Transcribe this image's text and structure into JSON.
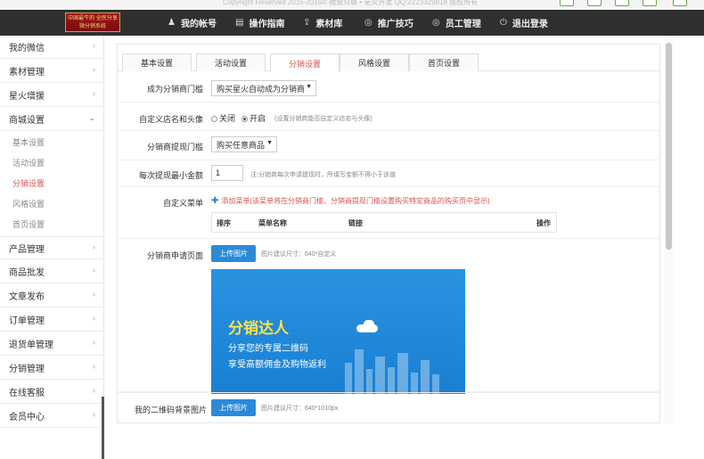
{
  "topbar": {
    "copyright": "Copyright Reserved 2015-2016© 微聚众联 • 星火开发 QQ:2223329818 版权所有"
  },
  "logo": {
    "text": "中国最牛的 全民分享微分销系统"
  },
  "nav": [
    {
      "label": "我的帐号",
      "icon": "user-icon"
    },
    {
      "label": "操作指南",
      "icon": "book-icon"
    },
    {
      "label": "素材库",
      "icon": "upload-icon"
    },
    {
      "label": "推广技巧",
      "icon": "globe-icon"
    },
    {
      "label": "员工管理",
      "icon": "globe-icon"
    },
    {
      "label": "退出登录",
      "icon": "power-icon"
    }
  ],
  "sidebar": {
    "items_top": [
      "我的微信",
      "素材管理",
      "星火增援",
      "商城设置"
    ],
    "sub_items": [
      "基本设置",
      "活动设置",
      "分销设置",
      "风格设置",
      "首页设置"
    ],
    "active_sub": "分销设置",
    "items_bottom": [
      "产品管理",
      "商品批发",
      "文章发布",
      "订单管理",
      "退货单管理",
      "分销管理",
      "在线客服",
      "会员中心"
    ]
  },
  "tabs": [
    "基本设置",
    "活动设置",
    "分销设置",
    "风格设置",
    "首页设置"
  ],
  "active_tab": "分销设置",
  "form": {
    "threshold_label": "成为分销商门槛",
    "threshold_value": "购买星火自动成为分销商",
    "custom_label": "自定义店名和头像",
    "radio_off": "关闭",
    "radio_on": "开启",
    "custom_hint": "(设置分销商能否自定义店名与头像)",
    "withdraw_label": "分销商提现门槛",
    "withdraw_value": "购买任意商品",
    "min_label": "每次提现最小金额",
    "min_value": "1",
    "min_hint": "注:分销商每次申请提现时，所填写金额不得小于该值",
    "menu_label": "自定义菜单",
    "add_menu": "添加菜单(该菜单将在分销商门槛、分销商提现门槛设置购买特定商品的购买页中显示)",
    "menu_cols": [
      "排序",
      "菜单名称",
      "链接",
      "操作"
    ],
    "apply_label": "分销商申请页面",
    "upload_label": "上传图片",
    "apply_hint": "图片建议尺寸：640*自定义",
    "banner_title": "分销达人",
    "banner_line1": "分享您的专属二维码",
    "banner_line2": "享受高额佣金及购物返利",
    "qr_label": "我的二维码背景图片",
    "qr_hint": "图片建议尺寸：640*1010px"
  },
  "colors": {
    "accent": "#d9534f",
    "nav_bg": "#2f2f2f",
    "button": "#2b8ad8"
  }
}
